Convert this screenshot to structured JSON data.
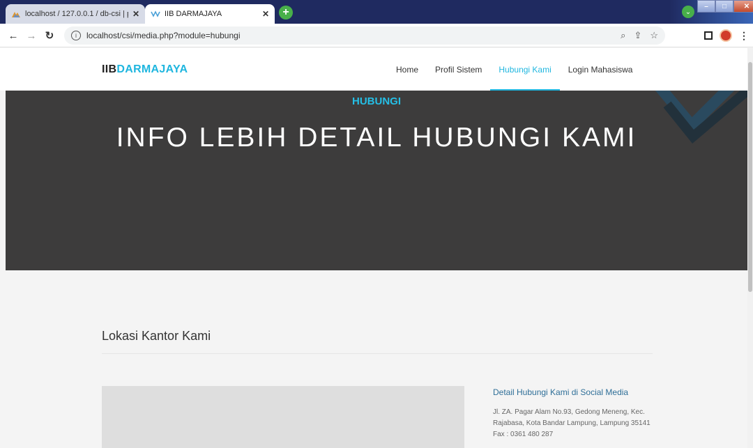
{
  "browser": {
    "tabs": [
      {
        "title": "localhost / 127.0.0.1 / db-csi | ph",
        "active": false
      },
      {
        "title": "IIB DARMAJAYA",
        "active": true
      }
    ],
    "address": "localhost/csi/media.php?module=hubungi"
  },
  "site": {
    "logo": {
      "part1": "IIB",
      "part2": "DARMAJAYA"
    },
    "nav": [
      {
        "label": "Home",
        "active": false
      },
      {
        "label": "Profil Sistem",
        "active": false
      },
      {
        "label": "Hubungi Kami",
        "active": true
      },
      {
        "label": "Login Mahasiswa",
        "active": false
      }
    ],
    "accent_color": "#1fb6df",
    "hero_bg_color": "#3d3c3c"
  },
  "hero": {
    "kicker": "HUBUNGI",
    "title": "INFO LEBIH DETAIL HUBUNGI KAMI"
  },
  "section": {
    "title": "Lokasi Kantor Kami",
    "contact_heading": "Detail Hubungi Kami di Social Media",
    "address_line1": "Jl. ZA. Pagar Alam No.93, Gedong Meneng, Kec.",
    "address_line2": "Rajabasa, Kota Bandar Lampung, Lampung 35141",
    "fax": "Fax : 0361 480 287"
  }
}
